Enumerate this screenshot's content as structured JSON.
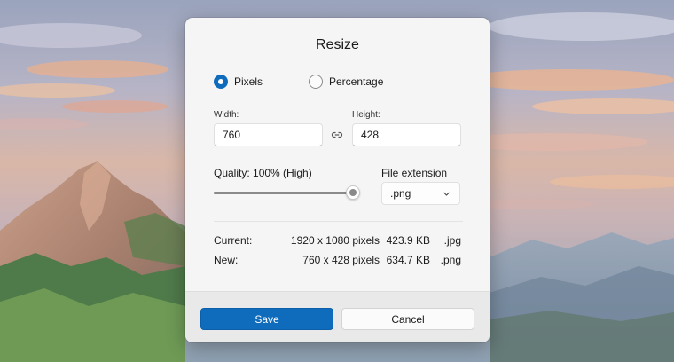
{
  "dialog": {
    "title": "Resize",
    "mode": {
      "options": [
        {
          "label": "Pixels",
          "selected": true
        },
        {
          "label": "Percentage",
          "selected": false
        }
      ]
    },
    "width": {
      "label": "Width:",
      "value": "760"
    },
    "height": {
      "label": "Height:",
      "value": "428"
    },
    "aspect_lock_icon": "link-icon",
    "quality": {
      "label": "Quality: 100% (High)",
      "value_percent": 100
    },
    "file_extension": {
      "label": "File extension",
      "selected": ".png",
      "icon": "chevron-down-icon"
    },
    "info": {
      "current": {
        "label": "Current:",
        "dims": "1920 x 1080 pixels",
        "size": "423.9 KB",
        "ext": ".jpg"
      },
      "new": {
        "label": "New:",
        "dims": "760 x 428 pixels",
        "size": "634.7 KB",
        "ext": ".png"
      }
    },
    "buttons": {
      "save": "Save",
      "cancel": "Cancel"
    }
  },
  "colors": {
    "accent": "#0f6cbd",
    "dialog_bg": "#f5f5f5",
    "footer_bg": "#e9e9e9"
  }
}
